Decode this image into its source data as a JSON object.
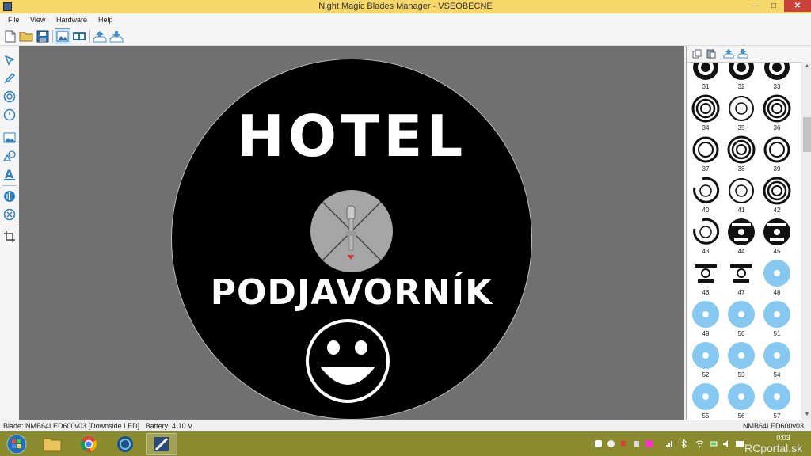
{
  "window": {
    "title": "Night Magic Blades Manager - VSEOBECNE"
  },
  "menu": {
    "items": [
      "File",
      "View",
      "Hardware",
      "Help"
    ]
  },
  "canvas": {
    "line1": "HOTEL",
    "line2": "PODJAVORNÍK",
    "background_color": "#707070",
    "disc_color": "#000000",
    "hub_color": "#a6a6a6"
  },
  "library": {
    "items": [
      {
        "num": "31",
        "style": "ring-black"
      },
      {
        "num": "32",
        "style": "ring-black"
      },
      {
        "num": "33",
        "style": "ring-black"
      },
      {
        "num": "34",
        "style": "ring-multi"
      },
      {
        "num": "35",
        "style": "ring-thin"
      },
      {
        "num": "36",
        "style": "ring-multi"
      },
      {
        "num": "37",
        "style": "ring-bold"
      },
      {
        "num": "38",
        "style": "ring-multi"
      },
      {
        "num": "39",
        "style": "ring-bold"
      },
      {
        "num": "40",
        "style": "ring-partial"
      },
      {
        "num": "41",
        "style": "ring-thin"
      },
      {
        "num": "42",
        "style": "ring-multi"
      },
      {
        "num": "43",
        "style": "ring-partial"
      },
      {
        "num": "44",
        "style": "logo"
      },
      {
        "num": "45",
        "style": "logo"
      },
      {
        "num": "46",
        "style": "logo-white"
      },
      {
        "num": "47",
        "style": "logo-white"
      },
      {
        "num": "48",
        "style": "blue"
      },
      {
        "num": "49",
        "style": "blue"
      },
      {
        "num": "50",
        "style": "blue"
      },
      {
        "num": "51",
        "style": "blue"
      },
      {
        "num": "52",
        "style": "blue"
      },
      {
        "num": "53",
        "style": "blue"
      },
      {
        "num": "54",
        "style": "blue"
      },
      {
        "num": "55",
        "style": "blue"
      },
      {
        "num": "56",
        "style": "blue"
      },
      {
        "num": "57",
        "style": "blue"
      }
    ]
  },
  "status": {
    "blade": "Blade: NMB64LED600v03 [Downside LED]",
    "battery": "Battery: 4,10 V",
    "device": "NMB64LED600v03"
  },
  "taskbar": {
    "clock": "0:03",
    "watermark": "RCportal.sk"
  },
  "icons": {
    "toolbar": [
      "new-file-icon",
      "open-folder-icon",
      "save-icon",
      "view-image-icon",
      "view-strip-icon",
      "upload-icon",
      "download-icon"
    ],
    "left": [
      "select-arrow-icon",
      "pencil-icon",
      "circle-icon",
      "clock-icon",
      "image-icon",
      "shapes-icon",
      "text-icon",
      "mirror-icon",
      "delete-icon",
      "crop-icon"
    ]
  },
  "colors": {
    "title_bar": "#f7d66a",
    "accent_blue": "#86c8f0",
    "close": "#c7433a"
  }
}
